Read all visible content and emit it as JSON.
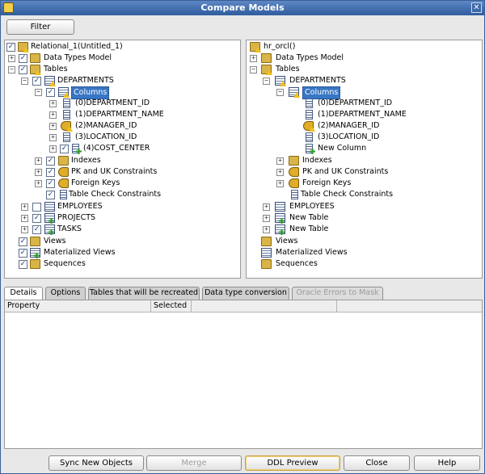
{
  "window": {
    "title": "Compare Models"
  },
  "toolbar": {
    "filter_label": "Filter"
  },
  "left_tree": {
    "root": "Relational_1(Untitled_1)",
    "data_types_model": "Data Types Model",
    "tables": "Tables",
    "departments": "DEPARTMENTS",
    "columns": "Columns",
    "col0": "(0)DEPARTMENT_ID",
    "col1": "(1)DEPARTMENT_NAME",
    "col2": "(2)MANAGER_ID",
    "col3": "(3)LOCATION_ID",
    "col4": "(4)COST_CENTER",
    "indexes": "Indexes",
    "pk_uk": "PK and UK Constraints",
    "foreign_keys": "Foreign Keys",
    "table_check": "Table Check Constraints",
    "employees": "EMPLOYEES",
    "projects": "PROJECTS",
    "tasks": "TASKS",
    "views": "Views",
    "mat_views": "Materialized Views",
    "sequences": "Sequences"
  },
  "right_tree": {
    "root": "hr_orcl()",
    "data_types_model": "Data Types Model",
    "tables": "Tables",
    "departments": "DEPARTMENTS",
    "columns": "Columns",
    "col0": "(0)DEPARTMENT_ID",
    "col1": "(1)DEPARTMENT_NAME",
    "col2": "(2)MANAGER_ID",
    "col3": "(3)LOCATION_ID",
    "new_column": "New Column",
    "indexes": "Indexes",
    "pk_uk": "PK and UK Constraints",
    "foreign_keys": "Foreign Keys",
    "table_check": "Table Check Constraints",
    "employees": "EMPLOYEES",
    "new_table_1": "New Table",
    "new_table_2": "New Table",
    "views": "Views",
    "mat_views": "Materialized Views",
    "sequences": "Sequences"
  },
  "tabs": [
    "Details",
    "Options",
    "Tables that will be recreated",
    "Data type conversion",
    "Oracle Errors to Mask"
  ],
  "grid": {
    "col_property": "Property",
    "col_selected": "Selected"
  },
  "buttons": {
    "sync": "Sync New Objects",
    "merge": "Merge",
    "ddl": "DDL Preview",
    "close": "Close",
    "help": "Help"
  }
}
